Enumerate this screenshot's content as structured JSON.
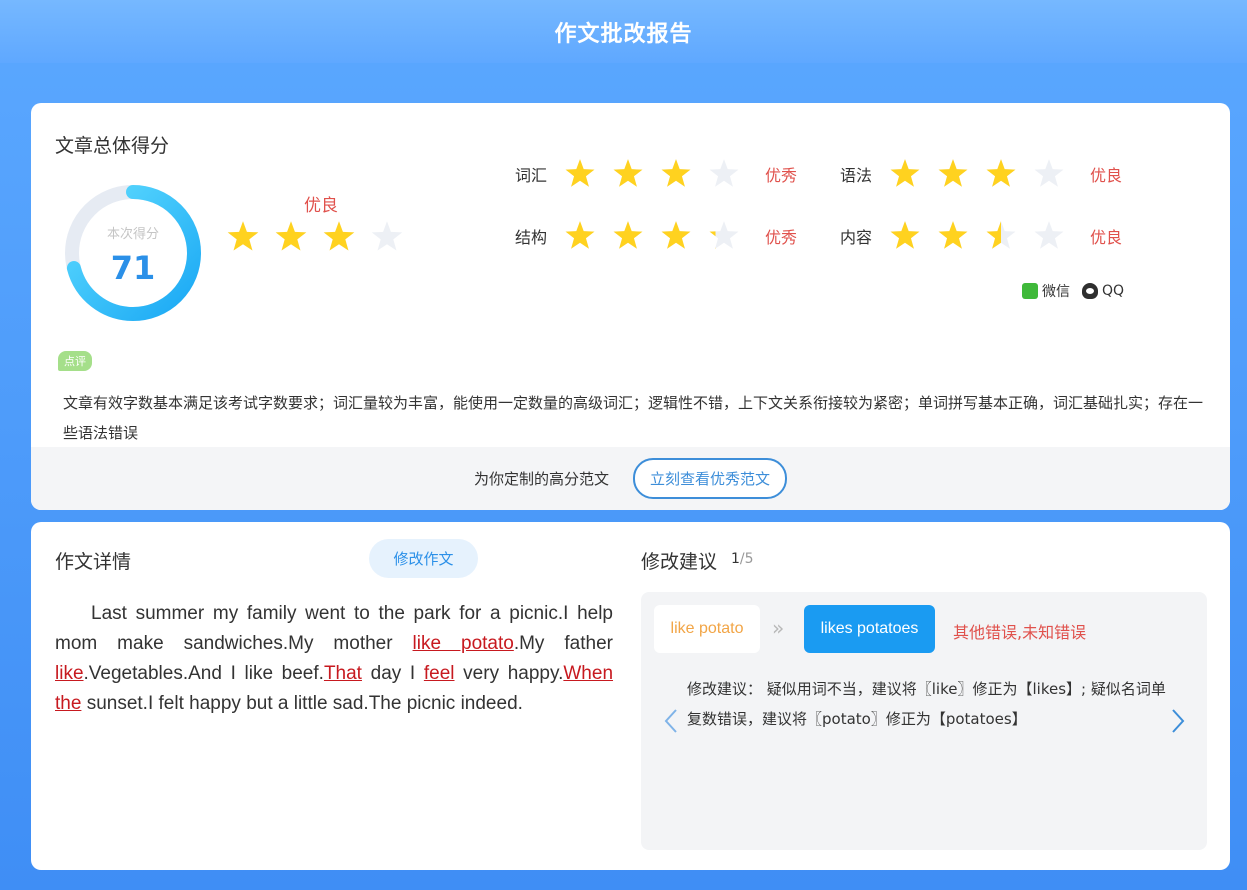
{
  "header": {
    "title": "作文批改报告"
  },
  "overall": {
    "title": "文章总体得分",
    "score_label": "本次得分",
    "score": "71",
    "score_fraction": 0.71,
    "grade": "优良",
    "stars": 3,
    "stars_max": 4
  },
  "metrics": [
    {
      "label": "词汇",
      "stars": 3,
      "grade": "优秀"
    },
    {
      "label": "语法",
      "stars": 3,
      "grade": "优良"
    },
    {
      "label": "结构",
      "stars": 3.25,
      "grade": "优秀"
    },
    {
      "label": "内容",
      "stars": 2.5,
      "grade": "优良"
    }
  ],
  "share": {
    "wechat": "微信",
    "qq": "QQ"
  },
  "comment": {
    "tag": "点评",
    "text": "文章有效字数基本满足该考试字数要求；词汇量较为丰富，能使用一定数量的高级词汇；逻辑性不错，上下文关系衔接较为紧密；单词拼写基本正确，词汇基础扎实；存在一些语法错误"
  },
  "footer": {
    "text": "为你定制的高分范文",
    "button": "立刻查看优秀范文"
  },
  "essay": {
    "title": "作文详情",
    "edit_button": "修改作文",
    "segments": [
      {
        "t": "Last summer my family went to the park for a picnic.I help mom make sandwiches.My mother ",
        "err": false
      },
      {
        "t": "like potato",
        "err": true
      },
      {
        "t": ".My father ",
        "err": false
      },
      {
        "t": "like",
        "err": true
      },
      {
        "t": ".Vegetables.And I like beef.",
        "err": false
      },
      {
        "t": "That",
        "err": true
      },
      {
        "t": " day I ",
        "err": false
      },
      {
        "t": "feel",
        "err": true
      },
      {
        "t": " very happy.",
        "err": false
      },
      {
        "t": "When the",
        "err": true
      },
      {
        "t": " sunset.I felt happy but a little sad.The picnic indeed.",
        "err": false
      }
    ]
  },
  "suggestion": {
    "title": "修改建议",
    "current": "1",
    "total": "/5",
    "original": "like potato",
    "corrected": "likes potatoes",
    "error_type": "其他错误,未知错误",
    "text": "修改建议：  疑似用词不当，建议将〖like〗修正为【likes】; 疑似名词单复数错误，建议将〖potato〗修正为【potatoes】"
  },
  "colors": {
    "background": "#4a98f8",
    "star_on": "#ffd21f",
    "star_off": "#edf0f5",
    "grade": "#e0514c",
    "error": "#c7191f",
    "accent": "#1a9bf2"
  }
}
